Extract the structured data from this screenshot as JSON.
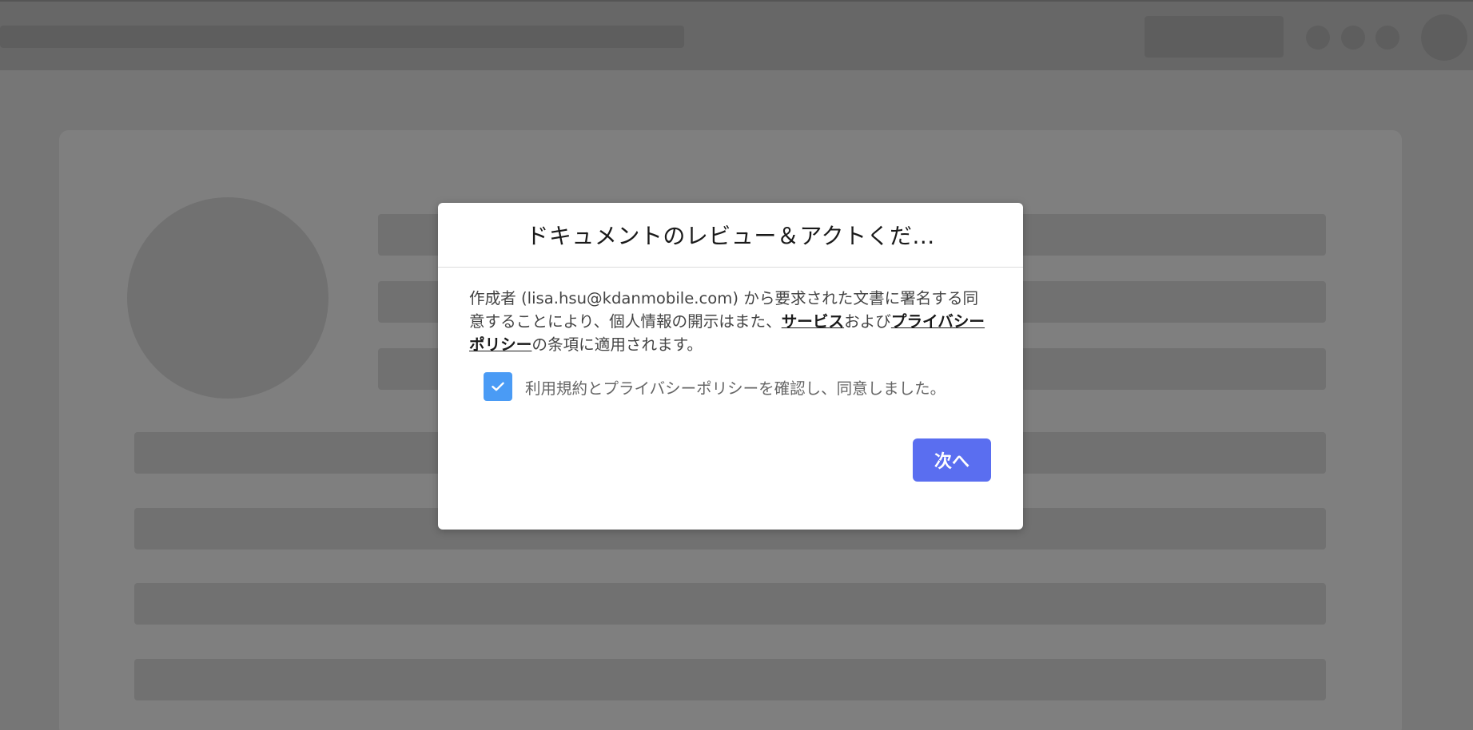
{
  "modal": {
    "title": "ドキュメントのレビュー＆アクトくだ...",
    "consent": {
      "part1": "作成者 (lisa.hsu@kdanmobile.com) から要求された文書に署名する同意することにより、個人情報の開示はまた、",
      "service_link": "サービス",
      "part2": "および",
      "privacy_link": "プライバシーポリシー",
      "part3": "の条項に適用されます。"
    },
    "agree": {
      "checked": true,
      "label": "利用規約とプライバシーポリシーを確認し、同意しました。",
      "icon": "check-icon"
    },
    "next_button_label": "次へ"
  },
  "colors": {
    "checkbox": "#4a9bf5",
    "next_button": "#5a6ef0",
    "overlay": "rgba(0,0,0,0.5)"
  }
}
